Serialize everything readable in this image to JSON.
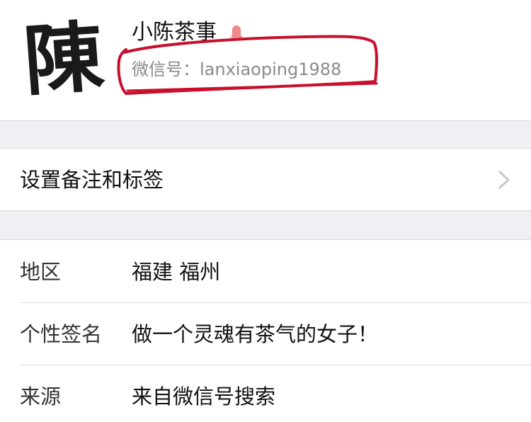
{
  "profile": {
    "avatar_char": "陳",
    "nickname": "小陈茶事",
    "wechat_id_label": "微信号：",
    "wechat_id_value": "lanxiaoping1988"
  },
  "colors": {
    "annotation": "#c8102e",
    "gender_badge": "#f08a8a",
    "section_bg": "#efeff4",
    "chevron": "#c7c7cc"
  },
  "icons": {
    "gender": "female-icon",
    "chevron": "chevron-right-icon"
  },
  "remark": {
    "label": "设置备注和标签"
  },
  "info": [
    {
      "label": "地区",
      "value": "福建 福州"
    },
    {
      "label": "个性签名",
      "value": "做一个灵魂有茶气的女子！"
    },
    {
      "label": "来源",
      "value": "来自微信号搜索"
    }
  ]
}
